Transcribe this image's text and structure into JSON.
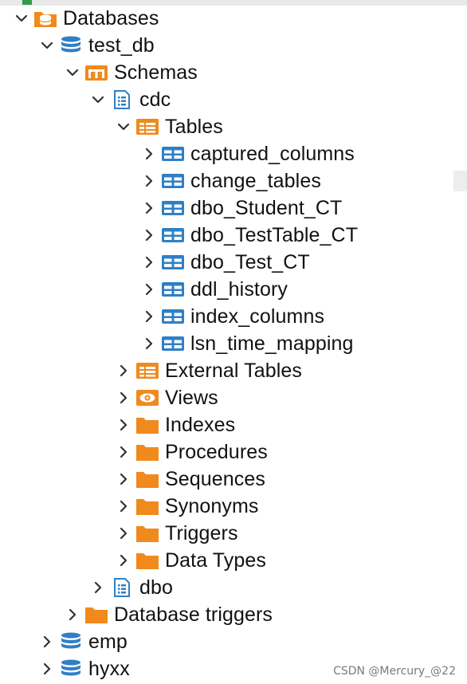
{
  "tree": [
    {
      "label": "Databases",
      "icon": "database-folder-icon",
      "expanded": true,
      "depth": 0
    },
    {
      "label": "test_db",
      "icon": "database-icon",
      "expanded": true,
      "depth": 1
    },
    {
      "label": "Schemas",
      "icon": "schemas-folder-icon",
      "expanded": true,
      "depth": 2
    },
    {
      "label": "cdc",
      "icon": "schema-icon",
      "expanded": true,
      "depth": 3
    },
    {
      "label": "Tables",
      "icon": "tables-folder-icon",
      "expanded": true,
      "depth": 4
    },
    {
      "label": "captured_columns",
      "icon": "table-icon",
      "expanded": false,
      "depth": 5
    },
    {
      "label": "change_tables",
      "icon": "table-icon",
      "expanded": false,
      "depth": 5
    },
    {
      "label": "dbo_Student_CT",
      "icon": "table-icon",
      "expanded": false,
      "depth": 5
    },
    {
      "label": "dbo_TestTable_CT",
      "icon": "table-icon",
      "expanded": false,
      "depth": 5
    },
    {
      "label": "dbo_Test_CT",
      "icon": "table-icon",
      "expanded": false,
      "depth": 5
    },
    {
      "label": "ddl_history",
      "icon": "table-icon",
      "expanded": false,
      "depth": 5
    },
    {
      "label": "index_columns",
      "icon": "table-icon",
      "expanded": false,
      "depth": 5
    },
    {
      "label": "lsn_time_mapping",
      "icon": "table-icon",
      "expanded": false,
      "depth": 5
    },
    {
      "label": "External Tables",
      "icon": "tables-folder-icon",
      "expanded": false,
      "depth": 4
    },
    {
      "label": "Views",
      "icon": "views-folder-icon",
      "expanded": false,
      "depth": 4
    },
    {
      "label": "Indexes",
      "icon": "folder-icon",
      "expanded": false,
      "depth": 4
    },
    {
      "label": "Procedures",
      "icon": "folder-icon",
      "expanded": false,
      "depth": 4
    },
    {
      "label": "Sequences",
      "icon": "folder-icon",
      "expanded": false,
      "depth": 4
    },
    {
      "label": "Synonyms",
      "icon": "folder-icon",
      "expanded": false,
      "depth": 4
    },
    {
      "label": "Triggers",
      "icon": "folder-icon",
      "expanded": false,
      "depth": 4
    },
    {
      "label": "Data Types",
      "icon": "folder-icon",
      "expanded": false,
      "depth": 4
    },
    {
      "label": "dbo",
      "icon": "schema-icon",
      "expanded": false,
      "depth": 3
    },
    {
      "label": "Database triggers",
      "icon": "folder-icon",
      "expanded": false,
      "depth": 2
    },
    {
      "label": "emp",
      "icon": "database-icon",
      "expanded": false,
      "depth": 1
    },
    {
      "label": "hyxx",
      "icon": "database-icon",
      "expanded": false,
      "depth": 1
    }
  ],
  "watermark": "CSDN @Mercury_@22",
  "colors": {
    "orange": "#f08a1c",
    "blue": "#2f7fc6",
    "chevron": "#333333"
  }
}
